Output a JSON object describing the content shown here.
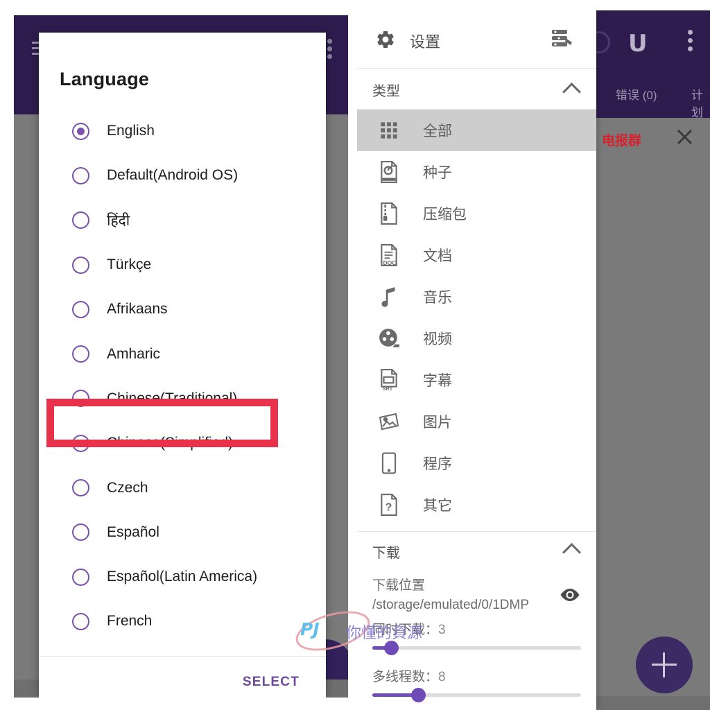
{
  "left_app": {
    "appbar": {
      "menu_icon": "hamburger-icon",
      "overflow_icon": "kebab-menu-icon"
    },
    "dialog": {
      "title": "Language",
      "select_label": "SELECT",
      "languages": [
        {
          "label": "English",
          "selected": true
        },
        {
          "label": "Default(Android OS)",
          "selected": false
        },
        {
          "label": "हिंदी",
          "selected": false
        },
        {
          "label": "Türkçe",
          "selected": false
        },
        {
          "label": "Afrikaans",
          "selected": false
        },
        {
          "label": "Amharic",
          "selected": false
        },
        {
          "label": "Chinese(Traditional)",
          "selected": false
        },
        {
          "label": "Chinese(Simplified)",
          "selected": false,
          "highlighted": true
        },
        {
          "label": "Czech",
          "selected": false
        },
        {
          "label": "Español",
          "selected": false
        },
        {
          "label": "Español(Latin America)",
          "selected": false
        },
        {
          "label": "French",
          "selected": false
        }
      ]
    },
    "annotation": {
      "type": "red-rectangle",
      "target": "Chinese(Simplified)",
      "color": "#e8314a"
    },
    "fab": {
      "icon": "add-icon"
    }
  },
  "right_app": {
    "appbar": {
      "magnet_icon": "magnet-icon",
      "overflow_icon": "kebab-menu-icon",
      "tabs": [
        {
          "label": "错误 (0)"
        },
        {
          "label": "计划"
        }
      ]
    },
    "banner": {
      "text": "电报群",
      "close_icon": "close-icon"
    },
    "drawer": {
      "header": {
        "gear_icon": "gear-icon",
        "title": "设置",
        "filter_icon": "filter-list-icon"
      },
      "type_section": {
        "label": "类型",
        "collapse_icon": "chevron-up-icon",
        "items": [
          {
            "label": "全部",
            "icon": "grid-icon",
            "active": true
          },
          {
            "label": "种子",
            "icon": "torrent-icon",
            "active": false
          },
          {
            "label": "压缩包",
            "icon": "zip-icon",
            "active": false
          },
          {
            "label": "文档",
            "icon": "doc-icon",
            "active": false
          },
          {
            "label": "音乐",
            "icon": "music-note-icon",
            "active": false
          },
          {
            "label": "视频",
            "icon": "film-reel-icon",
            "active": false
          },
          {
            "label": "字幕",
            "icon": "subtitle-icon",
            "active": false
          },
          {
            "label": "图片",
            "icon": "image-icon",
            "active": false
          },
          {
            "label": "程序",
            "icon": "phone-app-icon",
            "active": false
          },
          {
            "label": "其它",
            "icon": "question-file-icon",
            "active": false
          }
        ]
      },
      "download_section": {
        "label": "下载",
        "collapse_icon": "chevron-up-icon",
        "location_label": "下载位置",
        "location_value": "/storage/emulated/0/1DMP",
        "eye_icon": "eye-icon",
        "sliders": [
          {
            "label": "同时下载：",
            "value": "3",
            "percent": 9
          },
          {
            "label": "多线程数：",
            "value": "8",
            "percent": 22
          }
        ]
      }
    },
    "fab": {
      "icon": "add-icon"
    }
  },
  "watermark": {
    "brand": "PJ",
    "text": "你懂的資源"
  },
  "colors": {
    "accent_purple": "#7b52ab",
    "appbar_purple": "#2e1c4e",
    "annotation_red": "#e8314a",
    "scrim_gray": "#7a7a7a",
    "active_row_gray": "#cdcdcd"
  }
}
